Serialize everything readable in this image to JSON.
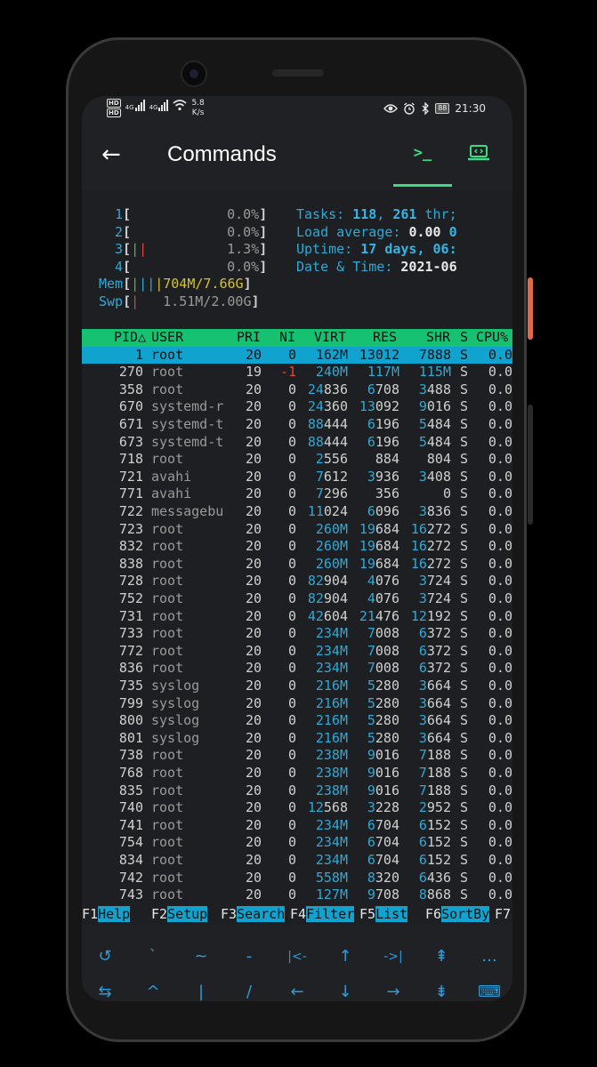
{
  "status_bar": {
    "left_badges": [
      "HD",
      "HD"
    ],
    "network_labels": [
      "4G",
      "4G"
    ],
    "speed_value": "5.8",
    "speed_unit": "K/s",
    "battery": "88",
    "time": "21:30"
  },
  "appbar": {
    "back_icon": "←",
    "title": "Commands",
    "terminal_tab_icon": ">_",
    "desktop_tab_icon": "laptop-code-icon"
  },
  "htop": {
    "cpus": [
      {
        "num": "1",
        "bar": "",
        "pct": "0.0%"
      },
      {
        "num": "2",
        "bar": "",
        "pct": "0.0%"
      },
      {
        "num": "3",
        "bar_green": "|",
        "bar_red": "|",
        "pct": "1.3%"
      },
      {
        "num": "4",
        "bar": "",
        "pct": "0.0%"
      }
    ],
    "mem": {
      "label": "Mem",
      "bars": "||||",
      "value": "704M/7.66G"
    },
    "swp": {
      "label": "Swp",
      "bars": "|",
      "value": "1.51M/2.00G"
    },
    "tasks_label": "Tasks: ",
    "tasks_value": "118",
    "tasks_sep": ", ",
    "threads_value": "261",
    "threads_label": " thr;",
    "load_label": "Load average: ",
    "load_value1": "0.00",
    "load_value2": "0",
    "uptime_label": "Uptime: ",
    "uptime_value": "17 days, 06:",
    "datetime_label": "Date & Time: ",
    "datetime_value": "2021-06",
    "columns": [
      "PID△",
      "USER",
      "PRI",
      "NI",
      "VIRT",
      "RES",
      "SHR",
      "S",
      "CPU%"
    ],
    "processes": [
      {
        "pid": "1",
        "user": "root",
        "pri": "20",
        "ni": "0",
        "virt": "162M",
        "res": "13012",
        "shr": "7888",
        "s": "S",
        "cpu": "0.0"
      },
      {
        "pid": "270",
        "user": "root",
        "pri": "19",
        "ni": "-1",
        "virt": "240M",
        "res": "117M",
        "shr": "115M",
        "s": "S",
        "cpu": "0.0"
      },
      {
        "pid": "358",
        "user": "root",
        "pri": "20",
        "ni": "0",
        "virt": "24836",
        "res": "6708",
        "shr": "3488",
        "s": "S",
        "cpu": "0.0"
      },
      {
        "pid": "670",
        "user": "systemd-r",
        "pri": "20",
        "ni": "0",
        "virt": "24360",
        "res": "13092",
        "shr": "9016",
        "s": "S",
        "cpu": "0.0"
      },
      {
        "pid": "671",
        "user": "systemd-t",
        "pri": "20",
        "ni": "0",
        "virt": "88444",
        "res": "6196",
        "shr": "5484",
        "s": "S",
        "cpu": "0.0"
      },
      {
        "pid": "673",
        "user": "systemd-t",
        "pri": "20",
        "ni": "0",
        "virt": "88444",
        "res": "6196",
        "shr": "5484",
        "s": "S",
        "cpu": "0.0"
      },
      {
        "pid": "718",
        "user": "root",
        "pri": "20",
        "ni": "0",
        "virt": "2556",
        "res": "884",
        "shr": "804",
        "s": "S",
        "cpu": "0.0"
      },
      {
        "pid": "721",
        "user": "avahi",
        "pri": "20",
        "ni": "0",
        "virt": "7612",
        "res": "3936",
        "shr": "3408",
        "s": "S",
        "cpu": "0.0"
      },
      {
        "pid": "771",
        "user": "avahi",
        "pri": "20",
        "ni": "0",
        "virt": "7296",
        "res": "356",
        "shr": "0",
        "s": "S",
        "cpu": "0.0"
      },
      {
        "pid": "722",
        "user": "messagebu",
        "pri": "20",
        "ni": "0",
        "virt": "11024",
        "res": "6096",
        "shr": "3836",
        "s": "S",
        "cpu": "0.0"
      },
      {
        "pid": "723",
        "user": "root",
        "pri": "20",
        "ni": "0",
        "virt": "260M",
        "res": "19684",
        "shr": "16272",
        "s": "S",
        "cpu": "0.0"
      },
      {
        "pid": "832",
        "user": "root",
        "pri": "20",
        "ni": "0",
        "virt": "260M",
        "res": "19684",
        "shr": "16272",
        "s": "S",
        "cpu": "0.0"
      },
      {
        "pid": "838",
        "user": "root",
        "pri": "20",
        "ni": "0",
        "virt": "260M",
        "res": "19684",
        "shr": "16272",
        "s": "S",
        "cpu": "0.0"
      },
      {
        "pid": "728",
        "user": "root",
        "pri": "20",
        "ni": "0",
        "virt": "82904",
        "res": "4076",
        "shr": "3724",
        "s": "S",
        "cpu": "0.0"
      },
      {
        "pid": "752",
        "user": "root",
        "pri": "20",
        "ni": "0",
        "virt": "82904",
        "res": "4076",
        "shr": "3724",
        "s": "S",
        "cpu": "0.0"
      },
      {
        "pid": "731",
        "user": "root",
        "pri": "20",
        "ni": "0",
        "virt": "42604",
        "res": "21476",
        "shr": "12192",
        "s": "S",
        "cpu": "0.0"
      },
      {
        "pid": "733",
        "user": "root",
        "pri": "20",
        "ni": "0",
        "virt": "234M",
        "res": "7008",
        "shr": "6372",
        "s": "S",
        "cpu": "0.0"
      },
      {
        "pid": "772",
        "user": "root",
        "pri": "20",
        "ni": "0",
        "virt": "234M",
        "res": "7008",
        "shr": "6372",
        "s": "S",
        "cpu": "0.0"
      },
      {
        "pid": "836",
        "user": "root",
        "pri": "20",
        "ni": "0",
        "virt": "234M",
        "res": "7008",
        "shr": "6372",
        "s": "S",
        "cpu": "0.0"
      },
      {
        "pid": "735",
        "user": "syslog",
        "pri": "20",
        "ni": "0",
        "virt": "216M",
        "res": "5280",
        "shr": "3664",
        "s": "S",
        "cpu": "0.0"
      },
      {
        "pid": "799",
        "user": "syslog",
        "pri": "20",
        "ni": "0",
        "virt": "216M",
        "res": "5280",
        "shr": "3664",
        "s": "S",
        "cpu": "0.0"
      },
      {
        "pid": "800",
        "user": "syslog",
        "pri": "20",
        "ni": "0",
        "virt": "216M",
        "res": "5280",
        "shr": "3664",
        "s": "S",
        "cpu": "0.0"
      },
      {
        "pid": "801",
        "user": "syslog",
        "pri": "20",
        "ni": "0",
        "virt": "216M",
        "res": "5280",
        "shr": "3664",
        "s": "S",
        "cpu": "0.0"
      },
      {
        "pid": "738",
        "user": "root",
        "pri": "20",
        "ni": "0",
        "virt": "238M",
        "res": "9016",
        "shr": "7188",
        "s": "S",
        "cpu": "0.0"
      },
      {
        "pid": "768",
        "user": "root",
        "pri": "20",
        "ni": "0",
        "virt": "238M",
        "res": "9016",
        "shr": "7188",
        "s": "S",
        "cpu": "0.0"
      },
      {
        "pid": "835",
        "user": "root",
        "pri": "20",
        "ni": "0",
        "virt": "238M",
        "res": "9016",
        "shr": "7188",
        "s": "S",
        "cpu": "0.0"
      },
      {
        "pid": "740",
        "user": "root",
        "pri": "20",
        "ni": "0",
        "virt": "12568",
        "res": "3228",
        "shr": "2952",
        "s": "S",
        "cpu": "0.0"
      },
      {
        "pid": "741",
        "user": "root",
        "pri": "20",
        "ni": "0",
        "virt": "234M",
        "res": "6704",
        "shr": "6152",
        "s": "S",
        "cpu": "0.0"
      },
      {
        "pid": "754",
        "user": "root",
        "pri": "20",
        "ni": "0",
        "virt": "234M",
        "res": "6704",
        "shr": "6152",
        "s": "S",
        "cpu": "0.0"
      },
      {
        "pid": "834",
        "user": "root",
        "pri": "20",
        "ni": "0",
        "virt": "234M",
        "res": "6704",
        "shr": "6152",
        "s": "S",
        "cpu": "0.0"
      },
      {
        "pid": "742",
        "user": "root",
        "pri": "20",
        "ni": "0",
        "virt": "558M",
        "res": "8320",
        "shr": "6436",
        "s": "S",
        "cpu": "0.0"
      },
      {
        "pid": "743",
        "user": "root",
        "pri": "20",
        "ni": "0",
        "virt": "127M",
        "res": "9708",
        "shr": "8868",
        "s": "S",
        "cpu": "0.0"
      }
    ],
    "fkeys": [
      {
        "key": "F1",
        "label": "Help  "
      },
      {
        "key": "F2",
        "label": "Setup "
      },
      {
        "key": "F3",
        "label": "Search"
      },
      {
        "key": "F4",
        "label": "Filter"
      },
      {
        "key": "F5",
        "label": "List  "
      },
      {
        "key": "F6",
        "label": "SortBy"
      },
      {
        "key": "F7",
        "label": ""
      }
    ]
  },
  "extra_keys": {
    "row1": [
      {
        "name": "history-icon",
        "glyph": "↺"
      },
      {
        "name": "backtick-key",
        "glyph": "`"
      },
      {
        "name": "tilde-key",
        "glyph": "~"
      },
      {
        "name": "minus-key",
        "glyph": "-"
      },
      {
        "name": "home-key",
        "glyph": "|<-"
      },
      {
        "name": "up-arrow-key",
        "glyph": "↑"
      },
      {
        "name": "end-key",
        "glyph": "->|"
      },
      {
        "name": "page-up-icon",
        "glyph": "⇞"
      },
      {
        "name": "more-key",
        "glyph": "..."
      }
    ],
    "row2": [
      {
        "name": "tab-icon",
        "glyph": "⇆"
      },
      {
        "name": "caret-key",
        "glyph": "^"
      },
      {
        "name": "pipe-key",
        "glyph": "|"
      },
      {
        "name": "slash-key",
        "glyph": "/"
      },
      {
        "name": "left-arrow-key",
        "glyph": "←"
      },
      {
        "name": "down-arrow-key",
        "glyph": "↓"
      },
      {
        "name": "right-arrow-key",
        "glyph": "→"
      },
      {
        "name": "page-down-icon",
        "glyph": "⇟"
      },
      {
        "name": "keyboard-icon",
        "glyph": "⌨"
      }
    ]
  }
}
